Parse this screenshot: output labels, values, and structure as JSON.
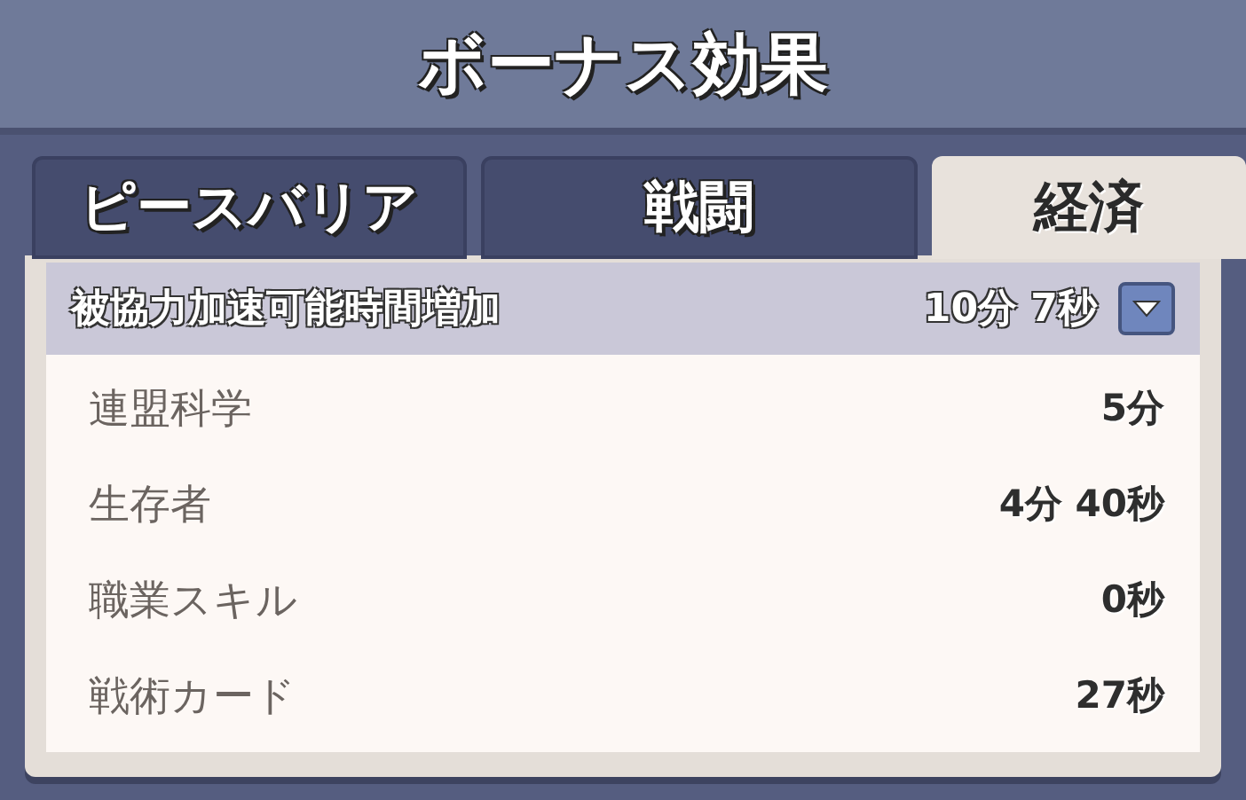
{
  "window": {
    "title": "ボーナス効果"
  },
  "tabs": [
    {
      "label": "ピースバリア",
      "selected": false
    },
    {
      "label": "戦闘",
      "selected": false
    },
    {
      "label": "経済",
      "selected": true
    }
  ],
  "effect": {
    "name": "被協力加速可能時間増加",
    "total": "10分 7秒",
    "expanded": true,
    "sources": [
      {
        "name": "連盟科学",
        "value": "5分"
      },
      {
        "name": "生存者",
        "value": "4分 40秒"
      },
      {
        "name": "職業スキル",
        "value": "0秒"
      },
      {
        "name": "戦術カード",
        "value": "27秒"
      }
    ]
  }
}
